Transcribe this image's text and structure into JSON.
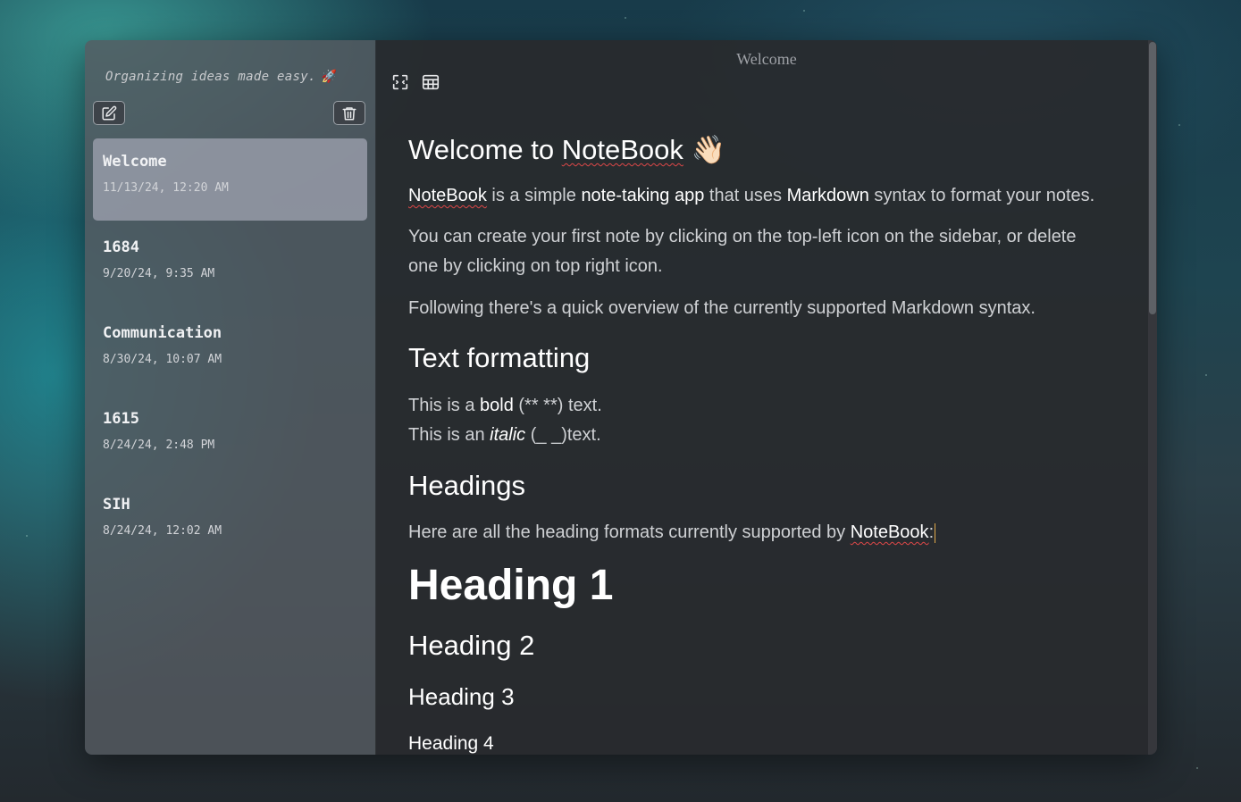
{
  "sidebar": {
    "tagline": "Organizing ideas made easy.",
    "tagline_emoji": "🚀",
    "notes": [
      {
        "title": "Welcome",
        "date": "11/13/24, 12:20 AM",
        "active": true
      },
      {
        "title": "1684",
        "date": "9/20/24, 9:35 AM"
      },
      {
        "title": "Communication",
        "date": "8/30/24, 10:07 AM"
      },
      {
        "title": "1615",
        "date": "8/24/24, 2:48 PM"
      },
      {
        "title": "SIH",
        "date": "8/24/24, 12:02 AM"
      }
    ]
  },
  "editor": {
    "doc_title": "Welcome",
    "h1_prefix": "Welcome to ",
    "h1_brand": "NoteBook",
    "h1_emoji": "👋🏻",
    "p1": {
      "brand": "NoteBook",
      "t1": " is a simple ",
      "b1": "note-taking app",
      "t2": " that uses ",
      "b2": "Markdown",
      "t3": " syntax to format your notes."
    },
    "p2": "You can create your first note by clicking on the top-left icon on the sidebar, or delete one by clicking on top right icon.",
    "p3": "Following there's a quick overview of the currently supported Markdown syntax.",
    "h_text_formatting": "Text formatting",
    "bold_line": {
      "t1": "This is a ",
      "b": "bold",
      "t2": " (** **) text."
    },
    "italic_line": {
      "t1": "This is an ",
      "i": "italic",
      "t2": " (_ _)text."
    },
    "h_headings": "Headings",
    "headings_line": {
      "t1": "Here are all the heading formats currently supported by ",
      "brand": "NoteBook",
      "t2": ":"
    },
    "heading1": "Heading 1",
    "heading2": "Heading 2",
    "heading3": "Heading 3",
    "heading4": "Heading 4"
  },
  "colors": {
    "accent_caret": "#e0a94a",
    "spell_underline": "#e04848"
  },
  "icons": [
    "new-note-icon",
    "trash-icon",
    "fullscreen-icon",
    "table-icon"
  ]
}
